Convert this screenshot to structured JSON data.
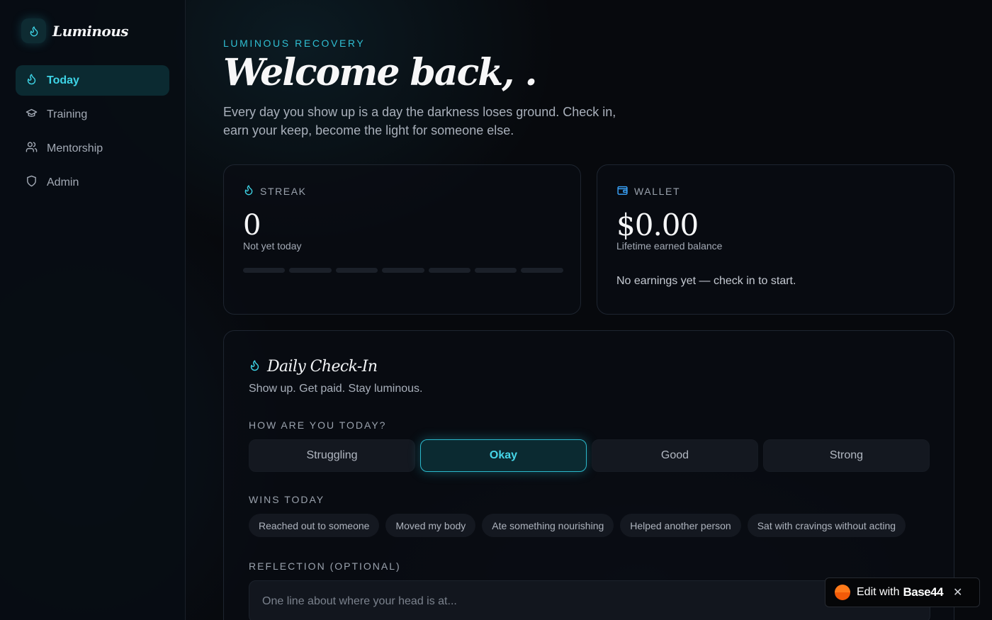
{
  "brand": {
    "name": "Luminous"
  },
  "nav": {
    "items": [
      {
        "label": "Today",
        "icon": "flame-icon",
        "active": true
      },
      {
        "label": "Training",
        "icon": "graduation-cap-icon",
        "active": false
      },
      {
        "label": "Mentorship",
        "icon": "users-icon",
        "active": false
      },
      {
        "label": "Admin",
        "icon": "shield-icon",
        "active": false
      }
    ]
  },
  "header": {
    "eyebrow": "LUMINOUS RECOVERY",
    "title": "Welcome back, .",
    "intro": "Every day you show up is a day the darkness loses ground. Check in, earn your keep, become the light for someone else."
  },
  "streak": {
    "label": "STREAK",
    "value": "0",
    "subtitle": "Not yet today",
    "days_filled": 0,
    "days_total": 7
  },
  "wallet": {
    "label": "WALLET",
    "value": "$0.00",
    "subtitle": "Lifetime earned balance",
    "note": "No earnings yet — check in to start."
  },
  "checkin": {
    "title": "Daily Check-In",
    "subtitle": "Show up. Get paid. Stay luminous.",
    "mood_label": "HOW ARE YOU TODAY?",
    "moods": [
      "Struggling",
      "Okay",
      "Good",
      "Strong"
    ],
    "selected_mood": "Okay",
    "wins_label": "WINS TODAY",
    "wins": [
      "Reached out to someone",
      "Moved my body",
      "Ate something nourishing",
      "Helped another person",
      "Sat with cravings without acting"
    ],
    "reflection_label": "REFLECTION (OPTIONAL)",
    "reflection_placeholder": "One line about where your head is at..."
  },
  "badge": {
    "prefix": "Edit with",
    "brand": "Base44",
    "close": "✕"
  },
  "colors": {
    "accent": "#2fbfd3",
    "background": "#07090d",
    "badge_orange": "#f26a0f"
  }
}
